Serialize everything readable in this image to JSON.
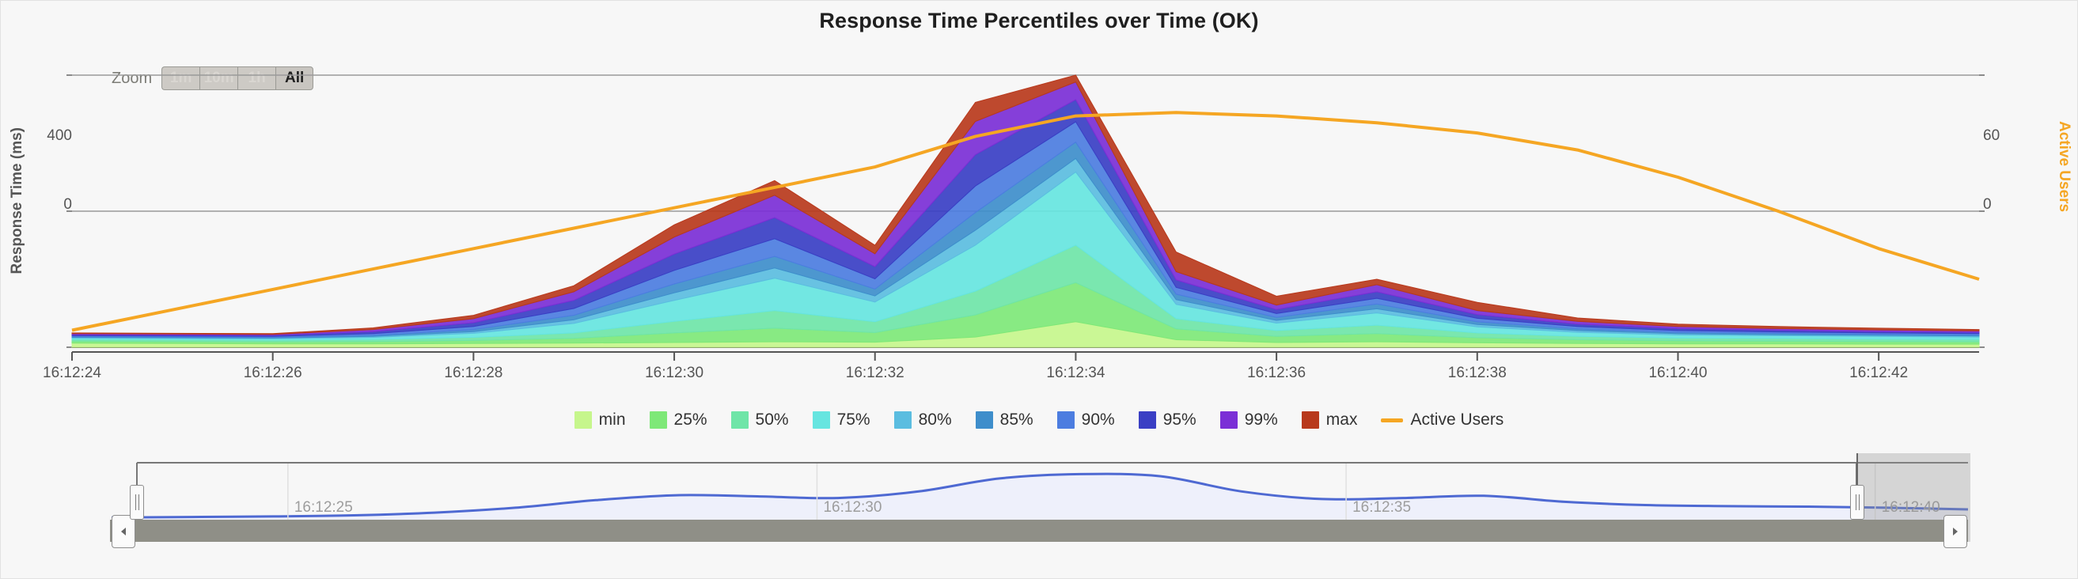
{
  "title": "Response Time Percentiles over Time (OK)",
  "zoom": {
    "label": "Zoom",
    "buttons": [
      {
        "label": "1m",
        "active": false
      },
      {
        "label": "10m",
        "active": false
      },
      {
        "label": "1h",
        "active": false
      },
      {
        "label": "All",
        "active": true
      }
    ]
  },
  "axes": {
    "left_title": "Response Time (ms)",
    "right_title": "Active Users",
    "left_ticks": [
      "400",
      "0"
    ],
    "right_ticks": [
      "60",
      "0"
    ],
    "x_ticks": [
      "16:12:24",
      "16:12:26",
      "16:12:28",
      "16:12:30",
      "16:12:32",
      "16:12:34",
      "16:12:36",
      "16:12:38",
      "16:12:40",
      "16:12:42"
    ]
  },
  "legend": [
    {
      "label": "min",
      "color": "#c6f68c",
      "marker": "swatch"
    },
    {
      "label": "25%",
      "color": "#7ee878",
      "marker": "swatch"
    },
    {
      "label": "50%",
      "color": "#6fe5a8",
      "marker": "swatch"
    },
    {
      "label": "75%",
      "color": "#66e5e0",
      "marker": "swatch"
    },
    {
      "label": "80%",
      "color": "#5bbde0",
      "marker": "swatch"
    },
    {
      "label": "85%",
      "color": "#3e8ecb",
      "marker": "swatch"
    },
    {
      "label": "90%",
      "color": "#4c7de0",
      "marker": "swatch"
    },
    {
      "label": "95%",
      "color": "#3a3fc4",
      "marker": "swatch"
    },
    {
      "label": "99%",
      "color": "#7b2fd6",
      "marker": "swatch"
    },
    {
      "label": "max",
      "color": "#b8391c",
      "marker": "swatch"
    },
    {
      "label": "Active Users",
      "color": "#f5a623",
      "marker": "line"
    }
  ],
  "navigator": {
    "labels": [
      "16:12:25",
      "16:12:30",
      "16:12:35",
      "16:12:40"
    ],
    "left_arrow": "◀",
    "right_arrow": "▶",
    "series_color": "#4e69d2"
  },
  "chart_data": {
    "type": "area",
    "title": "Response Time Percentiles over Time (OK)",
    "xlabel": "",
    "ylabel": "Response Time (ms)",
    "y2label": "Active Users",
    "ylim": [
      0,
      800
    ],
    "y2lim": [
      0,
      80
    ],
    "stacked": true,
    "grid": true,
    "legend_position": "bottom",
    "x": [
      "16:12:24",
      "16:12:25",
      "16:12:26",
      "16:12:27",
      "16:12:28",
      "16:12:29",
      "16:12:30",
      "16:12:31",
      "16:12:32",
      "16:12:33",
      "16:12:34",
      "16:12:35",
      "16:12:36",
      "16:12:37",
      "16:12:38",
      "16:12:39",
      "16:12:40",
      "16:12:41",
      "16:12:42",
      "16:12:43"
    ],
    "series": [
      {
        "name": "min",
        "color": "#c6f68c",
        "axis": "left",
        "values": [
          12,
          11,
          10,
          10,
          11,
          12,
          14,
          16,
          15,
          30,
          75,
          22,
          14,
          16,
          13,
          11,
          10,
          10,
          9,
          9
        ]
      },
      {
        "name": "25%",
        "color": "#7ee878",
        "axis": "left",
        "values": [
          6,
          6,
          6,
          7,
          9,
          14,
          28,
          40,
          28,
          65,
          115,
          32,
          18,
          24,
          15,
          11,
          9,
          8,
          8,
          7
        ]
      },
      {
        "name": "50%",
        "color": "#6fe5a8",
        "axis": "left",
        "values": [
          5,
          5,
          5,
          6,
          9,
          16,
          34,
          52,
          32,
          70,
          110,
          30,
          17,
          25,
          14,
          10,
          8,
          8,
          7,
          7
        ]
      },
      {
        "name": "75%",
        "color": "#66e5e0",
        "axis": "left",
        "values": [
          4,
          4,
          4,
          6,
          12,
          28,
          62,
          95,
          58,
          135,
          215,
          42,
          22,
          36,
          18,
          12,
          9,
          8,
          8,
          7
        ]
      },
      {
        "name": "80%",
        "color": "#5bbde0",
        "axis": "left",
        "values": [
          2,
          2,
          2,
          3,
          5,
          11,
          22,
          30,
          18,
          44,
          40,
          14,
          8,
          12,
          7,
          5,
          4,
          3,
          3,
          3
        ]
      },
      {
        "name": "85%",
        "color": "#3e8ecb",
        "axis": "left",
        "values": [
          2,
          2,
          2,
          3,
          6,
          13,
          26,
          34,
          20,
          52,
          48,
          16,
          9,
          14,
          8,
          5,
          4,
          4,
          3,
          3
        ]
      },
      {
        "name": "90%",
        "color": "#4c7de0",
        "axis": "left",
        "values": [
          3,
          3,
          3,
          5,
          9,
          20,
          40,
          52,
          30,
          78,
          60,
          20,
          11,
          17,
          10,
          7,
          5,
          4,
          4,
          4
        ]
      },
      {
        "name": "95%",
        "color": "#3a3fc4",
        "axis": "left",
        "values": [
          3,
          3,
          3,
          6,
          11,
          24,
          48,
          62,
          36,
          92,
          65,
          22,
          12,
          19,
          11,
          7,
          6,
          5,
          4,
          4
        ]
      },
      {
        "name": "99%",
        "color": "#7b2fd6",
        "axis": "left",
        "values": [
          3,
          3,
          3,
          6,
          12,
          25,
          50,
          66,
          38,
          98,
          52,
          24,
          13,
          21,
          12,
          8,
          6,
          5,
          5,
          4
        ]
      },
      {
        "name": "max",
        "color": "#b8391c",
        "axis": "left",
        "values": [
          2,
          2,
          2,
          5,
          10,
          18,
          36,
          43,
          25,
          56,
          20,
          58,
          26,
          16,
          24,
          10,
          7,
          6,
          5,
          4
        ]
      },
      {
        "name": "Active Users",
        "color": "#f5a623",
        "axis": "right",
        "kind": "line",
        "values": [
          5,
          11,
          17,
          23,
          29,
          35,
          41,
          47,
          53,
          62,
          68,
          69,
          68,
          66,
          63,
          58,
          50,
          40,
          29,
          20
        ]
      }
    ],
    "navigator_series": {
      "name": "Active Users",
      "color": "#4e69d2",
      "values": [
        4,
        5,
        6,
        8,
        13,
        22,
        36,
        45,
        43,
        40,
        52,
        76,
        84,
        80,
        52,
        38,
        40,
        44,
        33,
        27,
        25,
        24,
        22,
        19
      ]
    }
  }
}
